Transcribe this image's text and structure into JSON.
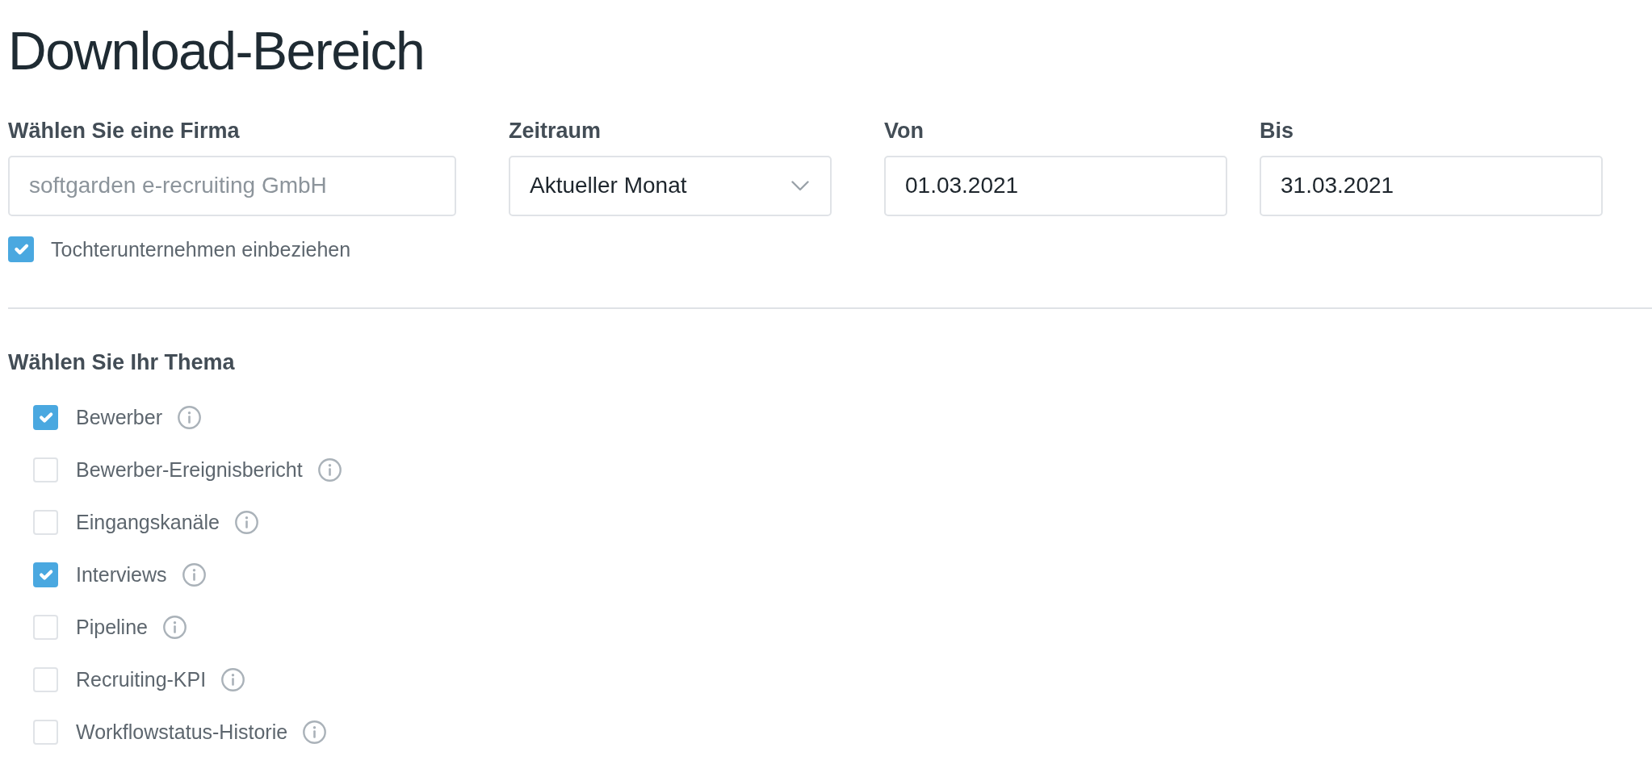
{
  "title": "Download-Bereich",
  "filters": [
    {
      "kind": "text",
      "label": "Wählen Sie eine Firma",
      "placeholder": "softgarden e-recruiting GmbH"
    },
    {
      "kind": "select",
      "label": "Zeitraum",
      "value": "Aktueller Monat"
    },
    {
      "kind": "date",
      "label": "Von",
      "value": "01.03.2021"
    },
    {
      "kind": "date",
      "label": "Bis",
      "value": "31.03.2021"
    }
  ],
  "include_subsidiaries": {
    "label": "Tochterunternehmen einbeziehen",
    "checked": true
  },
  "topics": {
    "heading": "Wählen Sie Ihr Thema",
    "items": [
      {
        "label": "Bewerber",
        "checked": true
      },
      {
        "label": "Bewerber-Ereignisbericht",
        "checked": false
      },
      {
        "label": "Eingangskanäle",
        "checked": false
      },
      {
        "label": "Interviews",
        "checked": true
      },
      {
        "label": "Pipeline",
        "checked": false
      },
      {
        "label": "Recruiting-KPI",
        "checked": false
      },
      {
        "label": "Workflowstatus-Historie",
        "checked": false
      }
    ]
  }
}
